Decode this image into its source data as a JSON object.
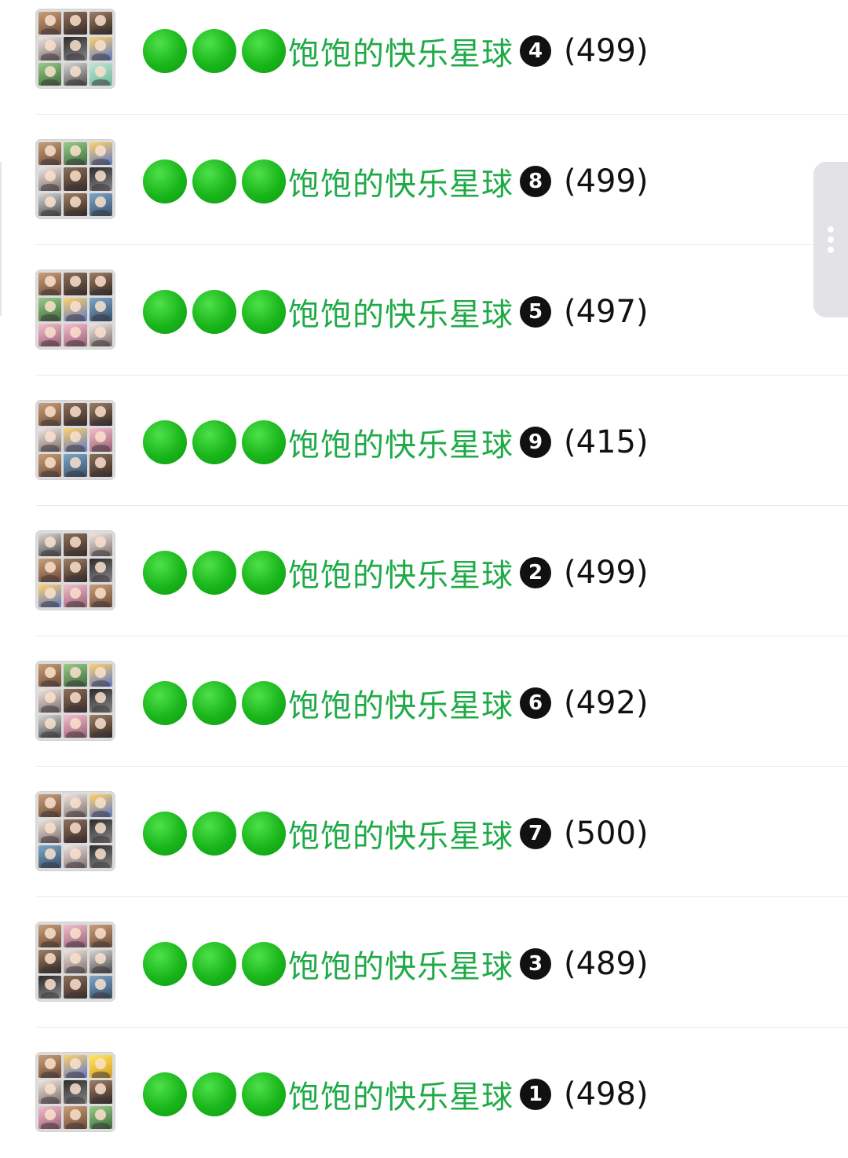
{
  "groups": [
    {
      "name": "饱饱的快乐星球",
      "number_badge": "4",
      "member_count": "(499)"
    },
    {
      "name": "饱饱的快乐星球",
      "number_badge": "8",
      "member_count": "(499)"
    },
    {
      "name": "饱饱的快乐星球",
      "number_badge": "5",
      "member_count": "(497)"
    },
    {
      "name": "饱饱的快乐星球",
      "number_badge": "9",
      "member_count": "(415)"
    },
    {
      "name": "饱饱的快乐星球",
      "number_badge": "2",
      "member_count": "(499)"
    },
    {
      "name": "饱饱的快乐星球",
      "number_badge": "6",
      "member_count": "(492)"
    },
    {
      "name": "饱饱的快乐星球",
      "number_badge": "7",
      "member_count": "(500)"
    },
    {
      "name": "饱饱的快乐星球",
      "number_badge": "3",
      "member_count": "(489)"
    },
    {
      "name": "饱饱的快乐星球",
      "number_badge": "1",
      "member_count": "(498)"
    }
  ],
  "icons": {
    "title_prefix": "green-circle-icon",
    "group_avatar": "group-avatar-grid",
    "side_handle": "more-vertical-icon"
  },
  "colors": {
    "group_name": "#1faa47",
    "green_circle": "#19b61b",
    "badge": "#111111",
    "divider": "#e9e9e9",
    "handle": "#e3e3e5"
  }
}
